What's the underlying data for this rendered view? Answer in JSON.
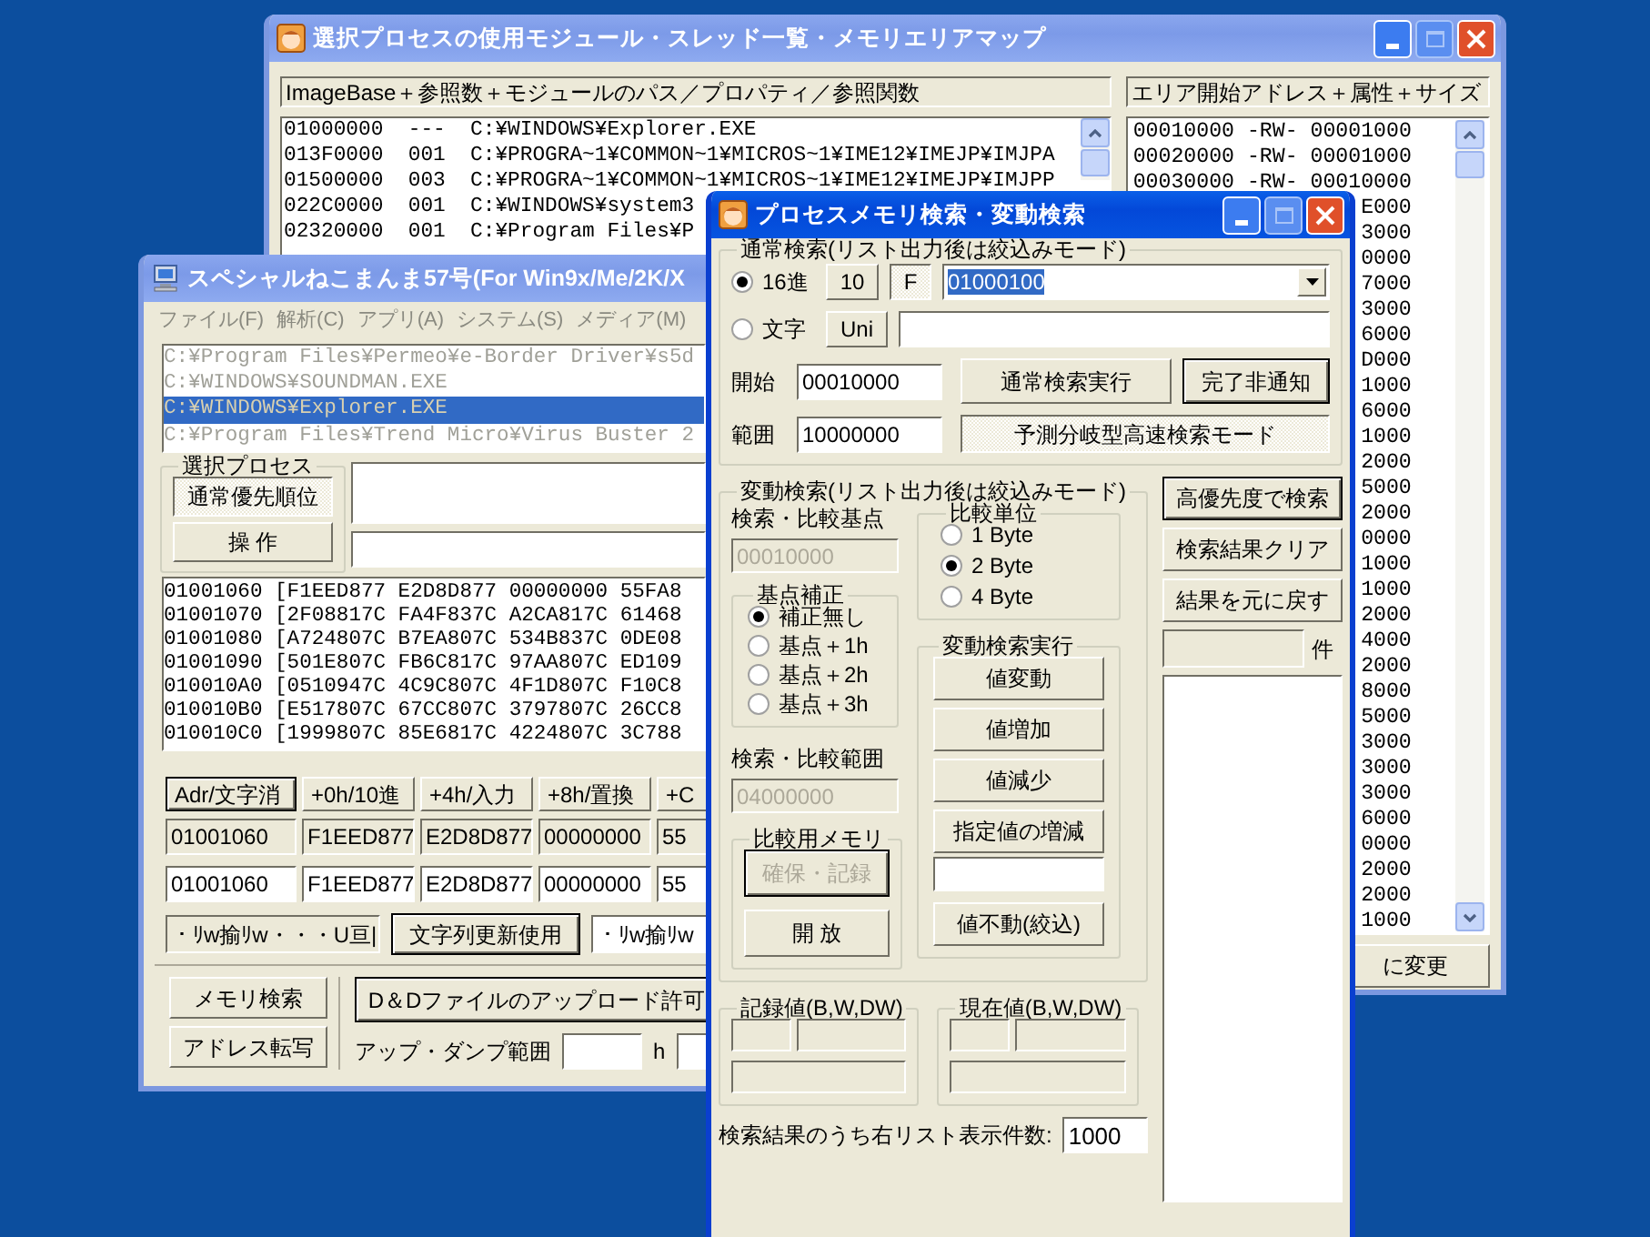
{
  "module_window": {
    "title": "選択プロセスの使用モジュール・スレッド一覧・メモリエリアマップ",
    "active": false,
    "module_header": "ImageBase＋参照数＋モジュールのパス／プロパティ／参照関数",
    "modules": [
      "01000000  ---  C:¥WINDOWS¥Explorer.EXE",
      "013F0000  001  C:¥PROGRA~1¥COMMON~1¥MICROS~1¥IME12¥IMEJP¥IMJPA",
      "01500000  003  C:¥PROGRA~1¥COMMON~1¥MICROS~1¥IME12¥IMEJP¥IMJPP",
      "022C0000  001  C:¥WINDOWS¥system3",
      "02320000  001  C:¥Program Files¥P"
    ],
    "area_header": "エリア開始アドレス＋属性＋サイズ",
    "areas": [
      "00010000 -RW- 00001000",
      "00020000 -RW- 00001000",
      "00030000 -RW- 00010000",
      "E000",
      "3000",
      "0000",
      "7000",
      "3000",
      "6000",
      "D000",
      "1000",
      "6000",
      "1000",
      "2000",
      "5000",
      "2000",
      "0000",
      "1000",
      "1000",
      "2000",
      "4000",
      "2000",
      "8000",
      "5000",
      "3000",
      "3000",
      "3000",
      "6000",
      "0000",
      "2000",
      "2000",
      "1000"
    ],
    "area_button": "に変更"
  },
  "main_window": {
    "title": "スペシャルねこまんま57号(For Win9x/Me/2K/X",
    "active": false,
    "menu": [
      "ファイル(F)",
      "解析(C)",
      "アプリ(A)",
      "システム(S)",
      "メディア(M)"
    ],
    "processes": [
      {
        "path": "C:¥Program Files¥Permeo¥e-Border Driver¥s5d",
        "selected": false
      },
      {
        "path": "C:¥WINDOWS¥SOUNDMAN.EXE",
        "selected": false
      },
      {
        "path": "C:¥WINDOWS¥Explorer.EXE",
        "selected": true
      },
      {
        "path": "C:¥Program Files¥Trend Micro¥Virus Buster 2",
        "selected": false
      }
    ],
    "process_group": "選択プロセス",
    "process_buttons": [
      {
        "label": "通常優先順位",
        "kind": "pressed"
      },
      {
        "label": "操 作",
        "kind": "normal"
      }
    ],
    "dump_rows": [
      "01001060 [F1EED877 E2D8D877 00000000 55FA8",
      "01001070 [2F08817C FA4F837C A2CA817C 61468",
      "01001080 [A724807C B7EA807C 534B837C 0DE08",
      "01001090 [501E807C FB6C817C 97AA807C ED109",
      "010010A0 [0510947C 4C9C807C 4F1D807C F10C8",
      "010010B0 [E517807C 67CC807C 3797807C 26CC8",
      "010010C0 [1999807C 85E6817C 4224807C 3C788"
    ],
    "offset_buttons": [
      {
        "label": "Adr/文字消",
        "kind": "default"
      },
      {
        "label": "+0h/10進",
        "kind": "normal"
      },
      {
        "label": "+4h/入力",
        "kind": "normal"
      },
      {
        "label": "+8h/置換",
        "kind": "normal"
      },
      {
        "label": "+C",
        "kind": "normal"
      }
    ],
    "value_row_1": [
      {
        "value": "01001060",
        "disabled": true
      },
      {
        "value": "F1EED877",
        "disabled": true
      },
      {
        "value": "E2D8D877",
        "disabled": true
      },
      {
        "value": "00000000",
        "disabled": true
      },
      {
        "value": "55",
        "disabled": true
      }
    ],
    "value_row_2": [
      {
        "value": "01001060",
        "disabled": false
      },
      {
        "value": "F1EED877",
        "disabled": false
      },
      {
        "value": "E2D8D877",
        "disabled": false
      },
      {
        "value": "00000000",
        "disabled": false
      },
      {
        "value": "55",
        "disabled": false
      }
    ],
    "string_field": {
      "value": "・ﾘw揄ﾘw・・・U亘|",
      "disabled": true
    },
    "string_button": {
      "label": "文字列更新使用",
      "kind": "default"
    },
    "string_field_2": {
      "value": "・ﾘw揄ﾘw",
      "disabled": false
    },
    "bottom_buttons": [
      {
        "label": "メモリ検索",
        "kind": "normal"
      },
      {
        "label": "アドレス転写",
        "kind": "normal"
      }
    ],
    "upload_button": {
      "label": "D＆Dファイルのアップロード許可",
      "kind": "default"
    },
    "range_label": "アップ・ダンプ範囲",
    "range_unit": "h"
  },
  "search_window": {
    "title": "プロセスメモリ検索・変動検索",
    "active": true,
    "normal_group": "通常検索(リスト出力後は絞込みモード)",
    "modes": [
      {
        "label": "16進",
        "selected": true
      },
      {
        "label": "文字",
        "selected": false
      }
    ],
    "radix_buttons": [
      {
        "label": "10",
        "kind": "normal"
      },
      {
        "label": "F",
        "kind": "pressed"
      }
    ],
    "search_value": "01000100",
    "unicode_button": {
      "label": "Uni",
      "kind": "normal"
    },
    "start_label": "開始",
    "start_value": "00010000",
    "range_label": "範囲",
    "range_value": "10000000",
    "run_button": {
      "label": "通常検索実行",
      "kind": "normal"
    },
    "notify_button": {
      "label": "完了非通知",
      "kind": "default"
    },
    "fast_button": {
      "label": "予測分岐型高速検索モード",
      "kind": "pressed"
    },
    "change_group": "変動検索(リスト出力後は絞込みモード)",
    "base_label": "検索・比較基点",
    "base_field": {
      "value": "00010000",
      "disabled": true
    },
    "offset_group": "基点補正",
    "offsets": [
      {
        "label": "補正無し",
        "selected": true
      },
      {
        "label": "基点＋1h",
        "selected": false
      },
      {
        "label": "基点＋2h",
        "selected": false
      },
      {
        "label": "基点＋3h",
        "selected": false
      }
    ],
    "range2_label": "検索・比較範囲",
    "range2_field": {
      "value": "04000000",
      "disabled": true
    },
    "memory_group": "比較用メモリ",
    "memory_buttons": [
      {
        "label": "確保・記録",
        "kind": "disabled"
      },
      {
        "label": "開 放",
        "kind": "normal"
      }
    ],
    "unit_group": "比較単位",
    "units": [
      {
        "label": "1 Byte",
        "selected": false
      },
      {
        "label": "2 Byte",
        "selected": true
      },
      {
        "label": "4 Byte",
        "selected": false
      }
    ],
    "exec_group": "変動検索実行",
    "exec_buttons": [
      {
        "label": "値変動",
        "kind": "normal"
      },
      {
        "label": "値増加",
        "kind": "normal"
      },
      {
        "label": "値減少",
        "kind": "normal"
      },
      {
        "label": "指定値の増減",
        "kind": "normal"
      }
    ],
    "exec_last": {
      "label": "値不動(絞込)",
      "kind": "normal"
    },
    "side_buttons": [
      {
        "label": "高優先度で検索",
        "kind": "default"
      },
      {
        "label": "検索結果クリア",
        "kind": "normal"
      },
      {
        "label": "結果を元に戻す",
        "kind": "normal"
      }
    ],
    "count_unit": "件",
    "recorded_group": "記録値(B,W,DW)",
    "current_group": "現在値(B,W,DW)",
    "list_count_label": "検索結果のうち右リスト表示件数:",
    "list_count_value": "1000"
  }
}
